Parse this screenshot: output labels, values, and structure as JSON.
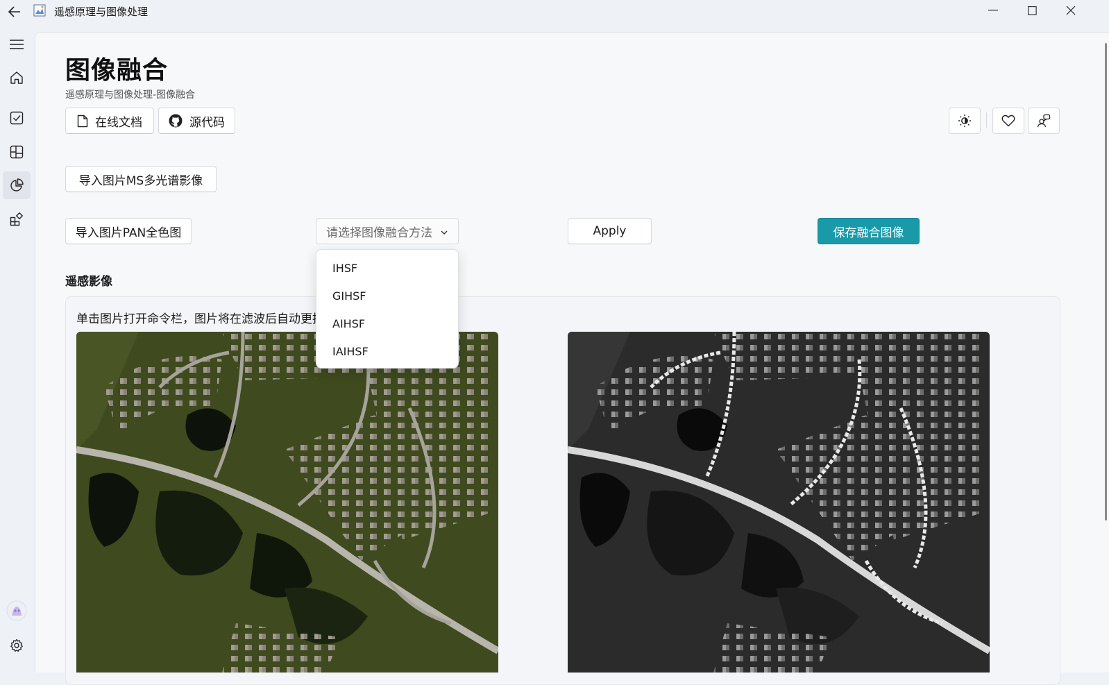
{
  "app": {
    "title": "遥感原理与图像处理"
  },
  "nav": {
    "items": [
      {
        "name": "menu"
      },
      {
        "name": "home"
      },
      {
        "name": "tasks"
      },
      {
        "name": "layout"
      },
      {
        "name": "charts"
      },
      {
        "name": "apps"
      }
    ],
    "active_index": 4
  },
  "page": {
    "title": "图像融合",
    "subtitle": "遥感原理与图像处理-图像融合",
    "doc_button": "在线文档",
    "source_button": "源代码"
  },
  "actions": {
    "import_ms": "导入图片MS多光谱影像",
    "import_pan": "导入图片PAN全色图",
    "method_placeholder": "请选择图像融合方法",
    "apply": "Apply",
    "save": "保存融合图像"
  },
  "dropdown": {
    "options": [
      "IHSF",
      "GIHSF",
      "AIHSF",
      "IAIHSF"
    ]
  },
  "section": {
    "title": "遥感影像",
    "hint": "单击图片打开命令栏，图片将在滤波后自动更拍"
  },
  "colors": {
    "accent": "#1a9aa8",
    "page_bg": "#f6f8fa",
    "chrome_bg": "#eef1f5"
  }
}
